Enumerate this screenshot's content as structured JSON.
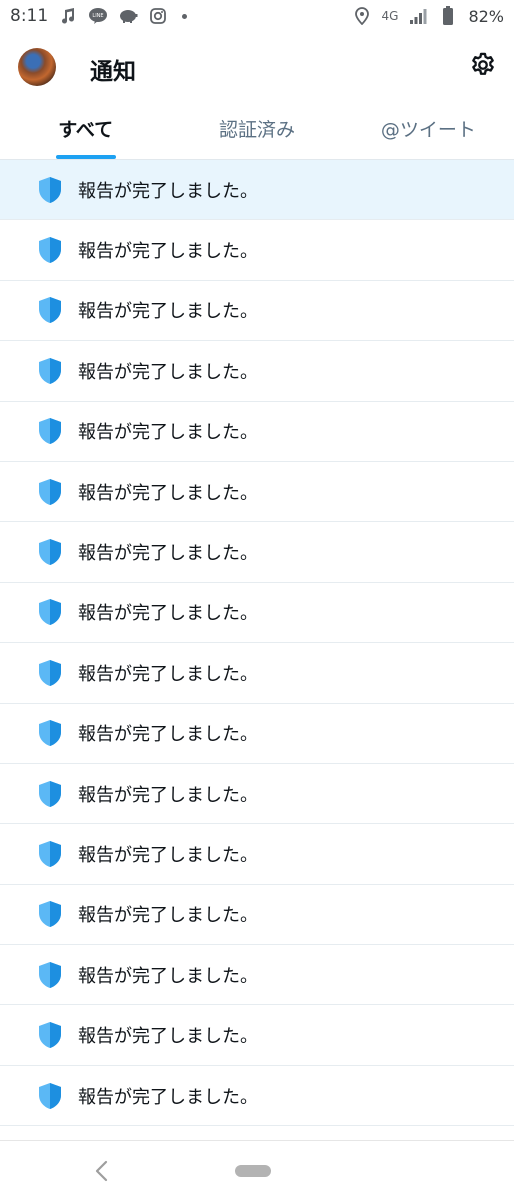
{
  "status_bar": {
    "time": "8:11",
    "left_icons": [
      "music-note-icon",
      "line-app-icon",
      "piggy-bank-icon",
      "instagram-icon",
      "dot-icon"
    ],
    "right_icons": [
      "location-icon",
      "signal-icon",
      "battery-icon"
    ],
    "network": "4G",
    "battery": "82%"
  },
  "header": {
    "title": "通知",
    "settings_icon": "gear-icon"
  },
  "tabs": [
    {
      "label": "すべて",
      "active": true
    },
    {
      "label": "認証済み",
      "active": false
    },
    {
      "label": "@ツイート",
      "active": false
    }
  ],
  "notifications": [
    {
      "text": "報告が完了しました。",
      "icon": "shield-icon",
      "highlighted": true
    },
    {
      "text": "報告が完了しました。",
      "icon": "shield-icon",
      "highlighted": false
    },
    {
      "text": "報告が完了しました。",
      "icon": "shield-icon",
      "highlighted": false
    },
    {
      "text": "報告が完了しました。",
      "icon": "shield-icon",
      "highlighted": false
    },
    {
      "text": "報告が完了しました。",
      "icon": "shield-icon",
      "highlighted": false
    },
    {
      "text": "報告が完了しました。",
      "icon": "shield-icon",
      "highlighted": false
    },
    {
      "text": "報告が完了しました。",
      "icon": "shield-icon",
      "highlighted": false
    },
    {
      "text": "報告が完了しました。",
      "icon": "shield-icon",
      "highlighted": false
    },
    {
      "text": "報告が完了しました。",
      "icon": "shield-icon",
      "highlighted": false
    },
    {
      "text": "報告が完了しました。",
      "icon": "shield-icon",
      "highlighted": false
    },
    {
      "text": "報告が完了しました。",
      "icon": "shield-icon",
      "highlighted": false
    },
    {
      "text": "報告が完了しました。",
      "icon": "shield-icon",
      "highlighted": false
    },
    {
      "text": "報告が完了しました。",
      "icon": "shield-icon",
      "highlighted": false
    },
    {
      "text": "報告が完了しました。",
      "icon": "shield-icon",
      "highlighted": false
    },
    {
      "text": "報告が完了しました。",
      "icon": "shield-icon",
      "highlighted": false
    },
    {
      "text": "報告が完了しました。",
      "icon": "shield-icon",
      "highlighted": false
    }
  ],
  "colors": {
    "accent": "#1da1f2",
    "highlight_bg": "#e8f5fd",
    "shield_light": "#5bb8f5",
    "shield_dark": "#1d8fe0"
  },
  "nav_bar": {
    "back_icon": "back-chevron-icon",
    "home_icon": "home-pill-icon"
  }
}
